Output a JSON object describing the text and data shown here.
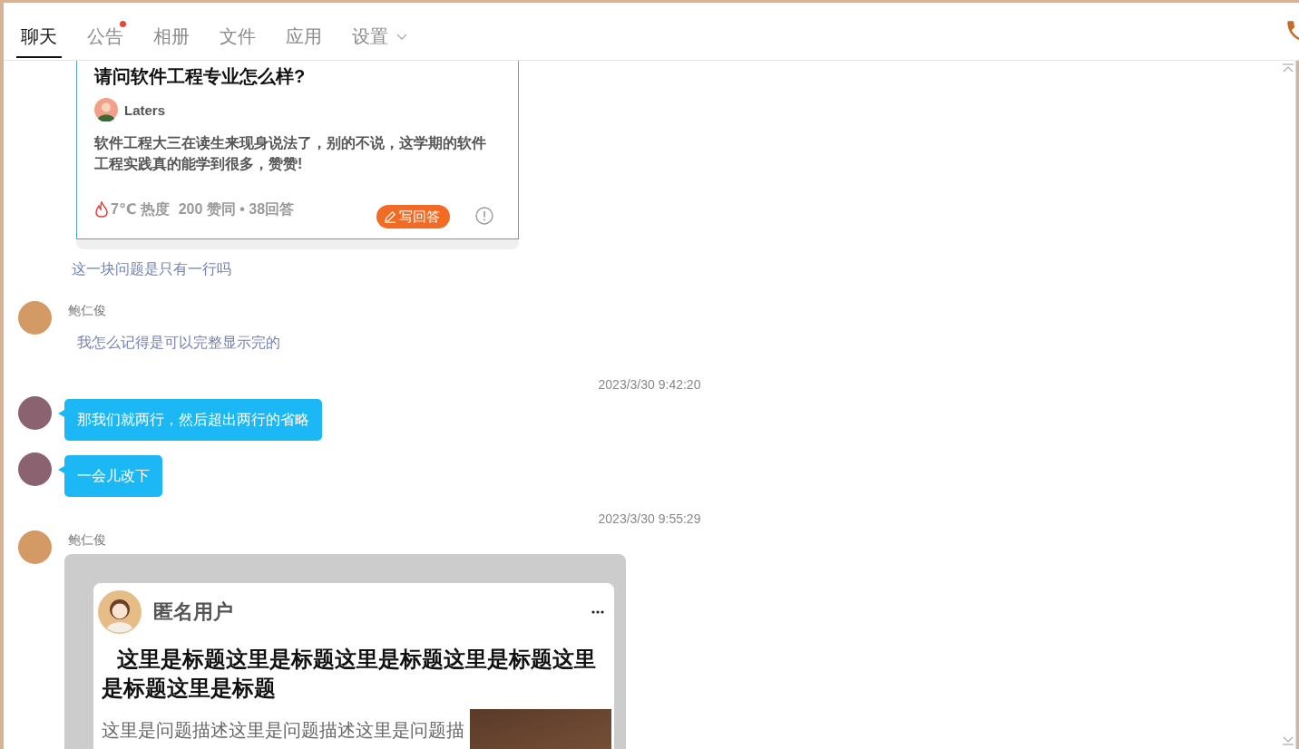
{
  "header": {
    "tabs": [
      {
        "label": "聊天",
        "selected": true,
        "badge": false,
        "dropdown": false
      },
      {
        "label": "公告",
        "selected": false,
        "badge": true,
        "dropdown": false
      },
      {
        "label": "相册",
        "selected": false,
        "badge": false,
        "dropdown": false
      },
      {
        "label": "文件",
        "selected": false,
        "badge": false,
        "dropdown": false
      },
      {
        "label": "应用",
        "selected": false,
        "badge": false,
        "dropdown": false
      },
      {
        "label": "设置",
        "selected": false,
        "badge": false,
        "dropdown": true
      }
    ]
  },
  "messages": [
    {
      "kind": "question_card",
      "title": "请问软件工程专业怎么样?",
      "author": "Laters",
      "excerpt": "软件工程大三在读生来现身说法了，别的不说，这学期的软件工程实践真的能学到很多，赞赞!",
      "heat": "7℃ 热度",
      "stats": "200 赞同 • 38回答",
      "action": "写回答"
    },
    {
      "kind": "text",
      "text": "这一块问题是只有一行吗"
    },
    {
      "kind": "incoming",
      "sender": "鲍仁俊",
      "text": "我怎么记得是可以完整显示完的"
    },
    {
      "kind": "time",
      "text": "2023/3/30 9:42:20"
    },
    {
      "kind": "bubble",
      "text": "那我们就两行，然后超出两行的省略"
    },
    {
      "kind": "bubble",
      "text": "一会儿改下"
    },
    {
      "kind": "time",
      "text": "2023/3/30 9:55:29"
    },
    {
      "kind": "post",
      "sender": "鲍仁俊",
      "user": "匿名用户",
      "title": "这里是标题这里是标题这里是标题这里是标题这里是标题这里是标题",
      "description": "这里是问题描述这里是问题描述这里是问题描"
    }
  ]
}
